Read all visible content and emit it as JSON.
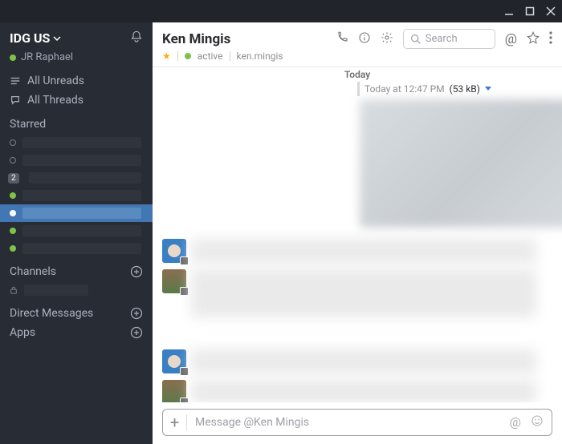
{
  "titlebar": {
    "minimize": "minimize",
    "maximize": "maximize",
    "close": "close"
  },
  "sidebar": {
    "team_name": "IDG US",
    "user_name": "JR Raphael",
    "all_unreads": "All Unreads",
    "all_threads": "All Threads",
    "starred_label": "Starred",
    "starred_badge": "2",
    "channels_label": "Channels",
    "direct_messages_label": "Direct Messages",
    "apps_label": "Apps"
  },
  "chat": {
    "name": "Ken Mingis",
    "status": "active",
    "username": "ken.mingis",
    "search_placeholder": "Search",
    "date_divider": "Today",
    "timestamp": "Today at 12:47 PM",
    "file_size": "(53 kB)",
    "compose_placeholder": "Message @Ken Mingis"
  }
}
